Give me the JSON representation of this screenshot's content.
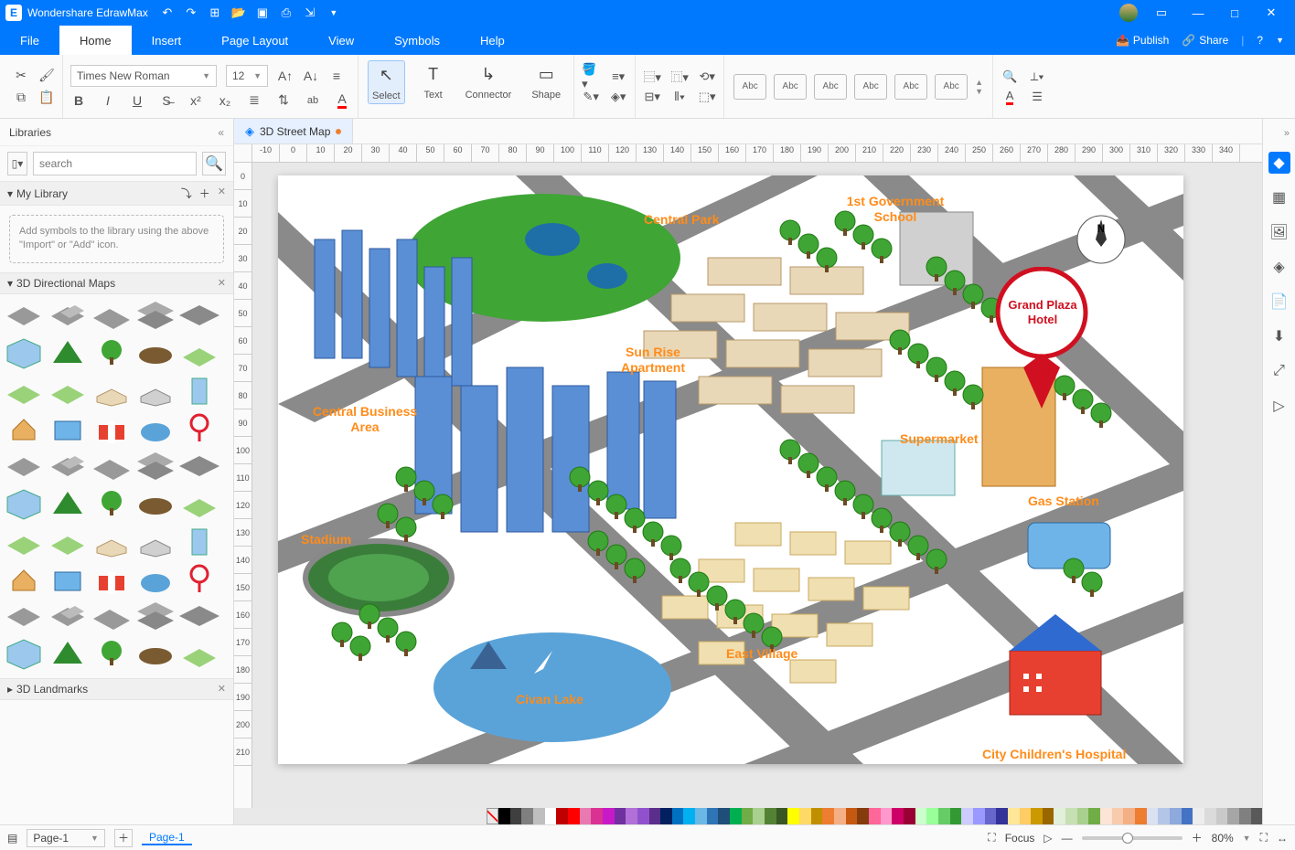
{
  "title": "Wondershare EdrawMax",
  "menu": {
    "file": "File",
    "home": "Home",
    "insert": "Insert",
    "pageLayout": "Page Layout",
    "view": "View",
    "symbols": "Symbols",
    "help": "Help"
  },
  "header_right": {
    "publish": "Publish",
    "share": "Share"
  },
  "ribbon": {
    "font": "Times New Roman",
    "size": "12",
    "tools": {
      "select": "Select",
      "text": "Text",
      "connector": "Connector",
      "shape": "Shape"
    },
    "abc": "Abc"
  },
  "libraries": {
    "header": "Libraries",
    "searchPlaceholder": "search",
    "myLibrary": "My Library",
    "hint": "Add symbols to the library using the above \"Import\" or \"Add\" icon.",
    "section2": "3D Directional Maps",
    "section3": "3D Landmarks"
  },
  "docTab": "3D Street Map",
  "ruler_h": [
    "-10",
    "0",
    "10",
    "20",
    "30",
    "40",
    "50",
    "60",
    "70",
    "80",
    "90",
    "100",
    "110",
    "120",
    "130",
    "140",
    "150",
    "160",
    "170",
    "180",
    "190",
    "200",
    "210",
    "220",
    "230",
    "240",
    "250",
    "260",
    "270",
    "280",
    "290",
    "300",
    "310",
    "320",
    "330",
    "340"
  ],
  "ruler_v": [
    "0",
    "10",
    "20",
    "30",
    "40",
    "50",
    "60",
    "70",
    "80",
    "90",
    "100",
    "110",
    "120",
    "130",
    "140",
    "150",
    "160",
    "170",
    "180",
    "190",
    "200",
    "210"
  ],
  "map_labels": {
    "centralPark": "Central Park",
    "govSchool": "1st Government School",
    "grandPlaza": "Grand Plaza Hotel",
    "cba": "Central Business Area",
    "sunrise": "Sun Rise Apartment",
    "supermarket": "Supermarket",
    "gasStation": "Gas Station",
    "stadium": "Stadium",
    "eastVillage": "East Village",
    "civanLake": "Civan Lake",
    "hospital": "City Children's Hospital"
  },
  "status": {
    "page": "Page-1",
    "pageLink": "Page-1",
    "focus": "Focus",
    "zoom": "80%"
  },
  "colors": [
    "#000000",
    "#3f3f3f",
    "#7f7f7f",
    "#bfbfbf",
    "#ffffff",
    "#c00000",
    "#ff0000",
    "#e97ab1",
    "#da3293",
    "#c819c8",
    "#7030a0",
    "#b070d8",
    "#8f52cc",
    "#5a2e8a",
    "#002060",
    "#0070c0",
    "#00b0f0",
    "#6bb8e6",
    "#2e75b6",
    "#1f4e79",
    "#00b050",
    "#70ad47",
    "#a9d08e",
    "#548235",
    "#385723",
    "#ffff00",
    "#ffd966",
    "#bf8f00",
    "#ed7d31",
    "#f4b084",
    "#c65911",
    "#843c0c",
    "#ff6699",
    "#ff99cc",
    "#cc0066",
    "#990033",
    "#ccffcc",
    "#99ff99",
    "#66cc66",
    "#339933",
    "#ccccff",
    "#9999ff",
    "#6666cc",
    "#333399",
    "#ffe699",
    "#ffcc66",
    "#cc9900",
    "#996600",
    "#e2efda",
    "#c6e0b4",
    "#a9d08e",
    "#70ad47",
    "#fce4d6",
    "#f8cbad",
    "#f4b084",
    "#ed7d31",
    "#d9e1f2",
    "#b4c6e7",
    "#8ea9db",
    "#4472c4",
    "#ededed",
    "#dbdbdb",
    "#c9c9c9",
    "#a6a6a6",
    "#808080",
    "#595959"
  ]
}
